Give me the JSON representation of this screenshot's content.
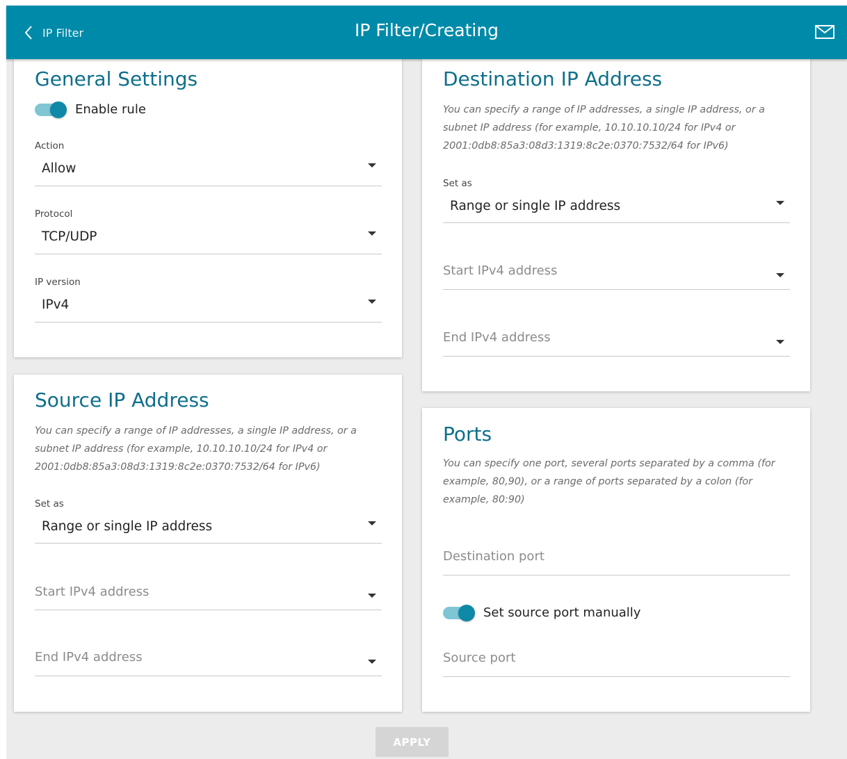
{
  "header": {
    "back_label": "IP Filter",
    "title": "IP Filter/Creating",
    "icons": {
      "back": "chevron-left-icon",
      "mail": "mail-icon"
    }
  },
  "general": {
    "title": "General Settings",
    "enable_label": "Enable rule",
    "enable_on": true,
    "action_label": "Action",
    "action_value": "Allow",
    "protocol_label": "Protocol",
    "protocol_value": "TCP/UDP",
    "ipversion_label": "IP version",
    "ipversion_value": "IPv4"
  },
  "source": {
    "title": "Source IP Address",
    "desc1": "You can specify a range of IP addresses, a single IP address, or a",
    "desc2": "subnet IP address (for example, 10.10.10.10/24 for IPv4 or",
    "desc3": "2001:0db8:85a3:08d3:1319:8c2e:0370:7532/64 for IPv6)",
    "setas_label": "Set as",
    "setas_value": "Range or single IP address",
    "start_placeholder": "Start IPv4 address",
    "end_placeholder": "End IPv4 address"
  },
  "destination": {
    "title": "Destination IP Address",
    "desc1": "You can specify a range of IP addresses, a single IP address, or a",
    "desc2": "subnet IP address (for example, 10.10.10.10/24 for IPv4 or",
    "desc3": "2001:0db8:85a3:08d3:1319:8c2e:0370:7532/64 for IPv6)",
    "setas_label": "Set as",
    "setas_value": "Range or single IP address",
    "start_placeholder": "Start IPv4 address",
    "end_placeholder": "End IPv4 address"
  },
  "ports": {
    "title": "Ports",
    "desc1": "You can specify one port, several ports separated by a comma (for",
    "desc2": "example, 80,90), or a range of ports separated by a colon (for",
    "desc3": "example, 80:90)",
    "dest_port_placeholder": "Destination port",
    "manual_label": "Set source port manually",
    "manual_on": true,
    "source_port_placeholder": "Source port"
  },
  "apply_label": "APPLY",
  "colors": {
    "header_bg": "#008aa9",
    "accent": "#0e6f8b",
    "toggle_knob": "#0e89a8",
    "toggle_track": "#7fc5d4",
    "apply_bg": "#d5d5d5"
  }
}
